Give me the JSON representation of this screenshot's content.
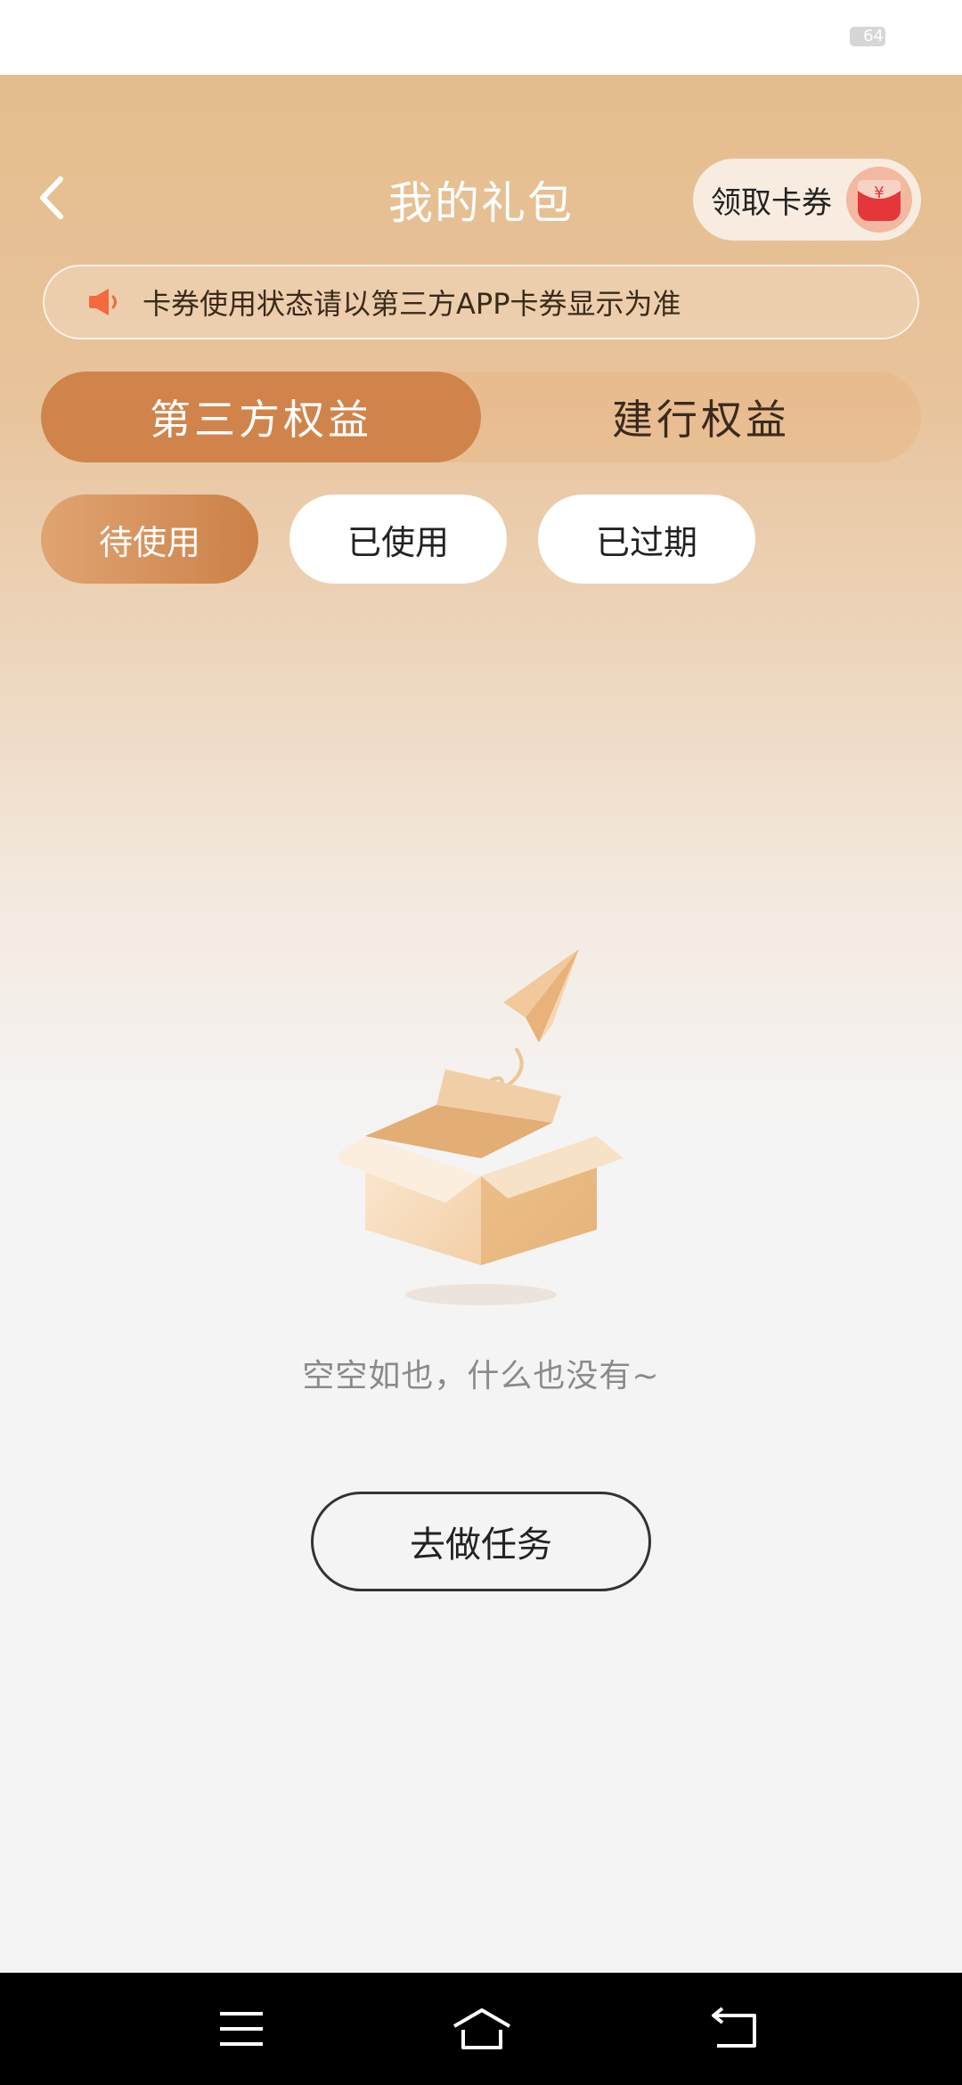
{
  "status_bar": {
    "battery_level": "64"
  },
  "header": {
    "title": "我的礼包",
    "coupon_button": "领取卡券",
    "coupon_symbol": "¥"
  },
  "notice": {
    "text": "卡券使用状态请以第三方APP卡券显示为准"
  },
  "main_tabs": [
    {
      "label": "第三方权益",
      "active": true
    },
    {
      "label": "建行权益",
      "active": false
    }
  ],
  "sub_tabs": [
    {
      "label": "待使用",
      "active": true
    },
    {
      "label": "已使用",
      "active": false
    },
    {
      "label": "已过期",
      "active": false
    }
  ],
  "empty_state": {
    "message": "空空如也，什么也没有~",
    "action_label": "去做任务"
  },
  "colors": {
    "accent": "#d0844c",
    "speaker": "#f26a3e",
    "coupon_red": "#e5363c"
  },
  "icons": {
    "back": "chevron-left-icon",
    "notice": "speaker-icon",
    "coupon": "red-envelope-icon",
    "nav": [
      "menu-icon",
      "home-icon",
      "back-arrow-icon"
    ]
  }
}
